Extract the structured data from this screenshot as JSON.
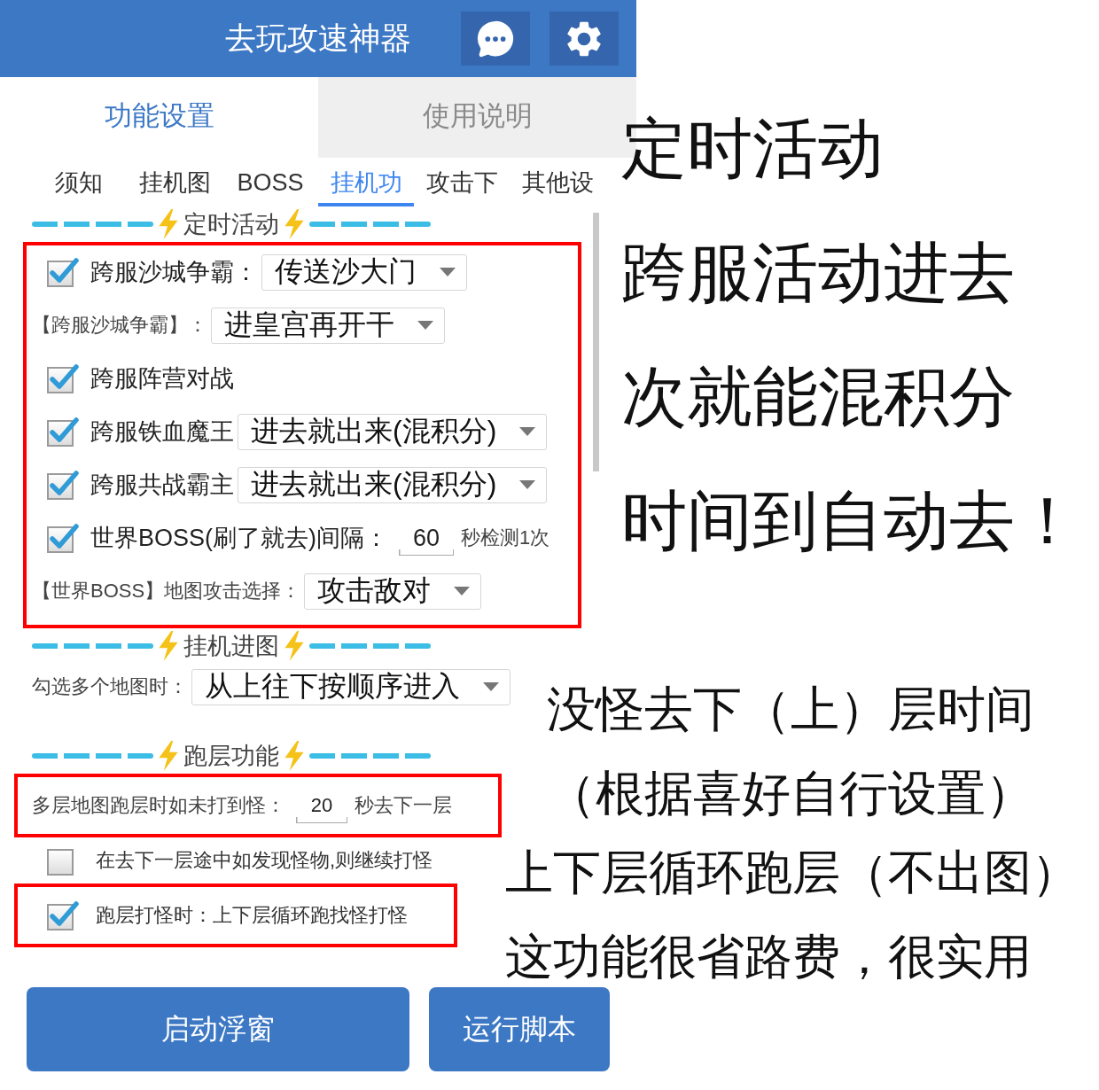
{
  "header": {
    "title": "去玩攻速神器",
    "buttons": [
      {
        "kind": "chat"
      },
      {
        "kind": "settings"
      }
    ]
  },
  "tabs": [
    {
      "label": "功能设置",
      "selected": true
    },
    {
      "label": "使用说明",
      "selected": false
    }
  ],
  "subtabs": [
    {
      "label": "须知",
      "selected": false
    },
    {
      "label": "挂机图",
      "selected": false
    },
    {
      "label": "BOSS",
      "selected": false
    },
    {
      "label": "挂机功",
      "selected": true
    },
    {
      "label": "攻击下",
      "selected": false
    },
    {
      "label": "其他设",
      "selected": false
    }
  ],
  "sections": [
    {
      "title": "定时活动",
      "groups": [
        {
          "framed": true,
          "rows": [
            {
              "kind": "check_select",
              "checked": true,
              "label": "跨服沙城争霸：",
              "value": "传送沙大门"
            },
            {
              "kind": "select",
              "label": "【跨服沙城争霸】：",
              "value": "进皇宫再开干"
            },
            {
              "kind": "check",
              "checked": true,
              "label": "跨服阵营对战"
            },
            {
              "kind": "check_select",
              "checked": true,
              "label": "跨服铁血魔王",
              "value": "进去就出来(混积分)"
            },
            {
              "kind": "check_select",
              "checked": true,
              "label": "跨服共战霸主",
              "value": "进去就出来(混积分)"
            },
            {
              "kind": "check_number",
              "checked": true,
              "label": "世界BOSS(刷了就去)间隔：",
              "value": "60",
              "suffix": "秒检测1次"
            },
            {
              "kind": "select",
              "label": "【世界BOSS】地图攻击选择：",
              "value": "攻击敌对"
            }
          ]
        }
      ]
    },
    {
      "title": "挂机进图",
      "groups": [
        {
          "framed": false,
          "rows": [
            {
              "kind": "select",
              "label": "勾选多个地图时：",
              "value": "从上往下按顺序进入"
            }
          ]
        }
      ]
    },
    {
      "title": "跑层功能",
      "groups": [
        {
          "framed": true,
          "rows": [
            {
              "kind": "number",
              "label": "多层地图跑层时如未打到怪：",
              "value": "20",
              "suffix": "秒去下一层"
            }
          ]
        },
        {
          "framed": false,
          "rows": [
            {
              "kind": "check",
              "checked": false,
              "label": "在去下一层途中如发现怪物,则继续打怪"
            }
          ]
        },
        {
          "framed": true,
          "rows": [
            {
              "kind": "check",
              "checked": true,
              "label": "跑层打怪时：上下层循环跑找怪打怪"
            }
          ]
        }
      ]
    }
  ],
  "actions": [
    {
      "label": "启动浮窗"
    },
    {
      "label": "运行脚本"
    }
  ],
  "notes": [
    {
      "lines": [
        "定时活动",
        "跨服活动进去",
        "次就能混积分",
        "时间到自动去！"
      ]
    },
    {
      "lines": [
        "没怪去下（上）层时间",
        "（根据喜好自行设置）"
      ]
    },
    {
      "lines": [
        "上下层循环跑层（不出图）",
        "这功能很省路费，很实用"
      ]
    }
  ]
}
